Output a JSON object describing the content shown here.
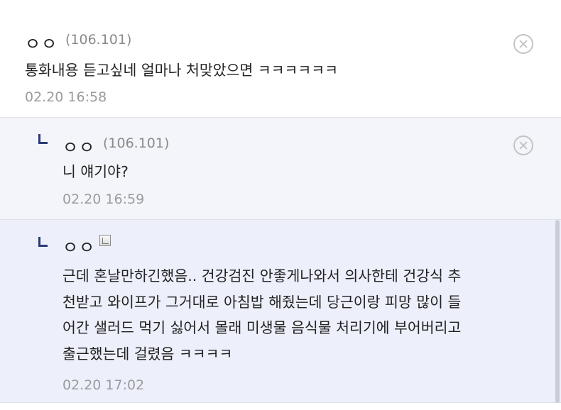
{
  "comments": [
    {
      "nickname": "ㅇㅇ",
      "ip": "(106.101)",
      "text_lines": [
        "통화내용 듣고싶네 얼마나 처맞았으면 ㅋㅋㅋㅋㅋㅋ"
      ],
      "date": "02.20 16:58",
      "delete_icon": "close-circle-icon"
    },
    {
      "nickname": "ㅇㅇ",
      "ip": "(106.101)",
      "text_lines": [
        "니 얘기야?"
      ],
      "date": "02.20 16:59",
      "delete_icon": "close-circle-icon"
    },
    {
      "nickname": "ㅇㅇ",
      "member_icon": "fixed-nick-icon",
      "text_lines": [
        "근데 혼날만하긴했음.. 건강검진 안좋게나와서 의사한테 건강식 추",
        "천받고 와이프가 그거대로 아침밥 해줬는데 당근이랑 피망 많이 들",
        "어간 샐러드 먹기 싫어서 몰래 미생물 음식물 처리기에 부어버리고",
        "출근했는데 걸렸음 ㅋㅋㅋㅋ"
      ],
      "date": "02.20 17:02"
    }
  ],
  "colors": {
    "reply_mark": "#2b3a78",
    "reply_bg": "#f4f5fa",
    "reply_highlight_bg": "#edf0fb"
  }
}
